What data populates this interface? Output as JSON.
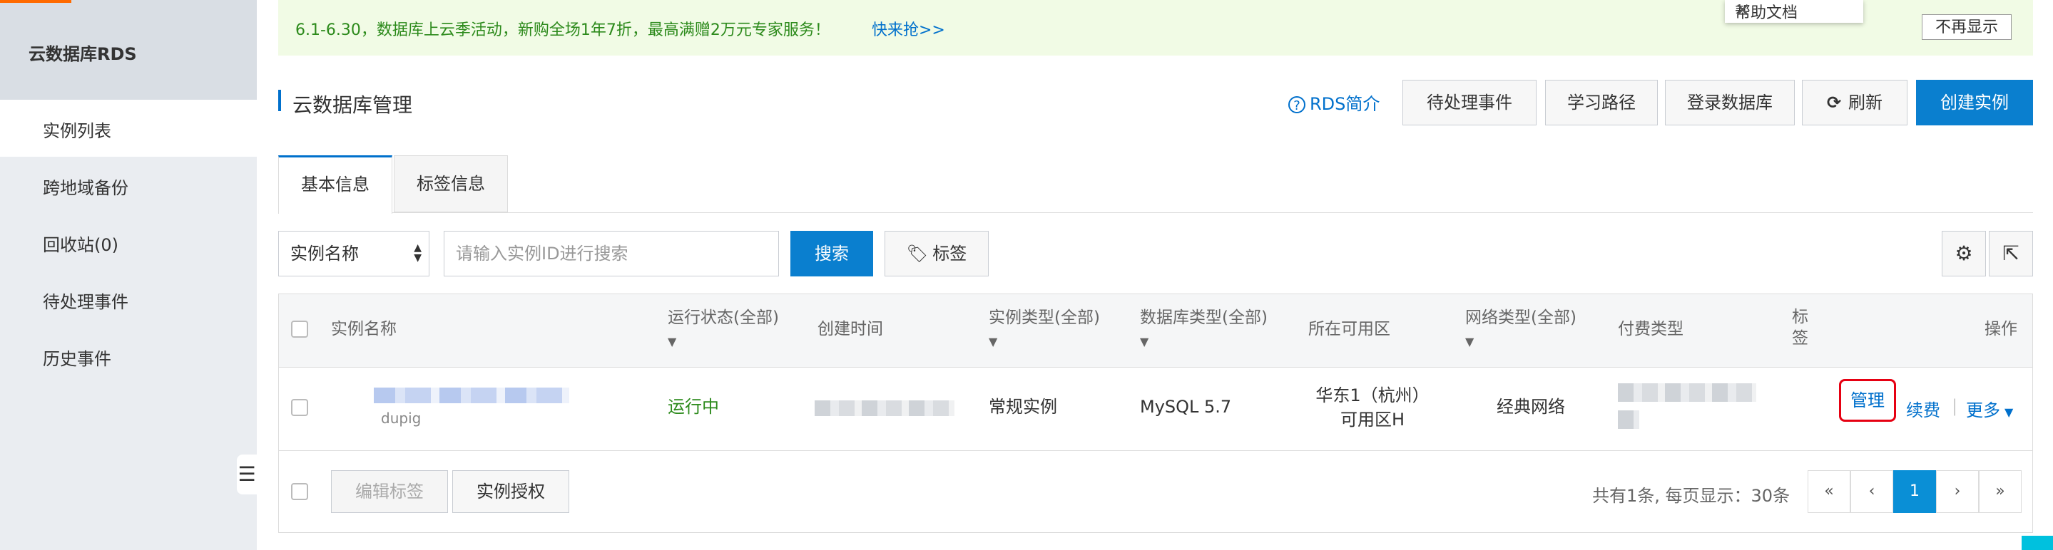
{
  "sidebar": {
    "title": "云数据库RDS",
    "items": [
      {
        "label": "实例列表",
        "active": true
      },
      {
        "label": "跨地域备份",
        "active": false
      },
      {
        "label": "回收站(0)",
        "active": false
      },
      {
        "label": "待处理事件",
        "active": false
      },
      {
        "label": "历史事件",
        "active": false
      }
    ],
    "collapse_icon": "collapse-icon"
  },
  "banner": {
    "text": "6.1-6.30，数据库上云季活动，新购全场1年7折，最高满赠2万元专家服务！",
    "link": "快来抢>>",
    "dismiss": "不再显示",
    "help_tip": "帮助文档"
  },
  "header": {
    "title": "云数据库管理",
    "rds_intro": "RDS简介",
    "buttons": {
      "pending_events": "待处理事件",
      "learning_path": "学习路径",
      "login_db": "登录数据库",
      "refresh": "刷新",
      "create": "创建实例"
    }
  },
  "tabs": [
    {
      "label": "基本信息",
      "active": true
    },
    {
      "label": "标签信息",
      "active": false
    }
  ],
  "search": {
    "select_value": "实例名称",
    "placeholder": "请输入实例ID进行搜索",
    "search_button": "搜索",
    "tag_button": "标签"
  },
  "table": {
    "columns": {
      "name": "实例名称",
      "status": "运行状态(全部)",
      "created": "创建时间",
      "type": "实例类型(全部)",
      "db_type": "数据库类型(全部)",
      "zone": "所在可用区",
      "network": "网络类型(全部)",
      "billing": "付费类型",
      "tags": "标签",
      "actions": "操作"
    },
    "rows": [
      {
        "name_suffix": "dupig",
        "status": "运行中",
        "type": "常规实例",
        "db_type": "MySQL 5.7",
        "zone_line1": "华东1（杭州）",
        "zone_line2": "可用区H",
        "network": "经典网络",
        "actions": {
          "manage": "管理",
          "renew": "续费",
          "more": "更多"
        }
      }
    ]
  },
  "footer": {
    "edit_tags": "编辑标签",
    "authorize": "实例授权",
    "total": "共有1条, 每页显示：30条",
    "pagination": {
      "first": "«",
      "prev": "‹",
      "current": "1",
      "next": "›",
      "last": "»"
    }
  },
  "colors": {
    "accent": "#0a7fcf",
    "status_running": "#2c8a1b",
    "highlight": "#e60012"
  }
}
